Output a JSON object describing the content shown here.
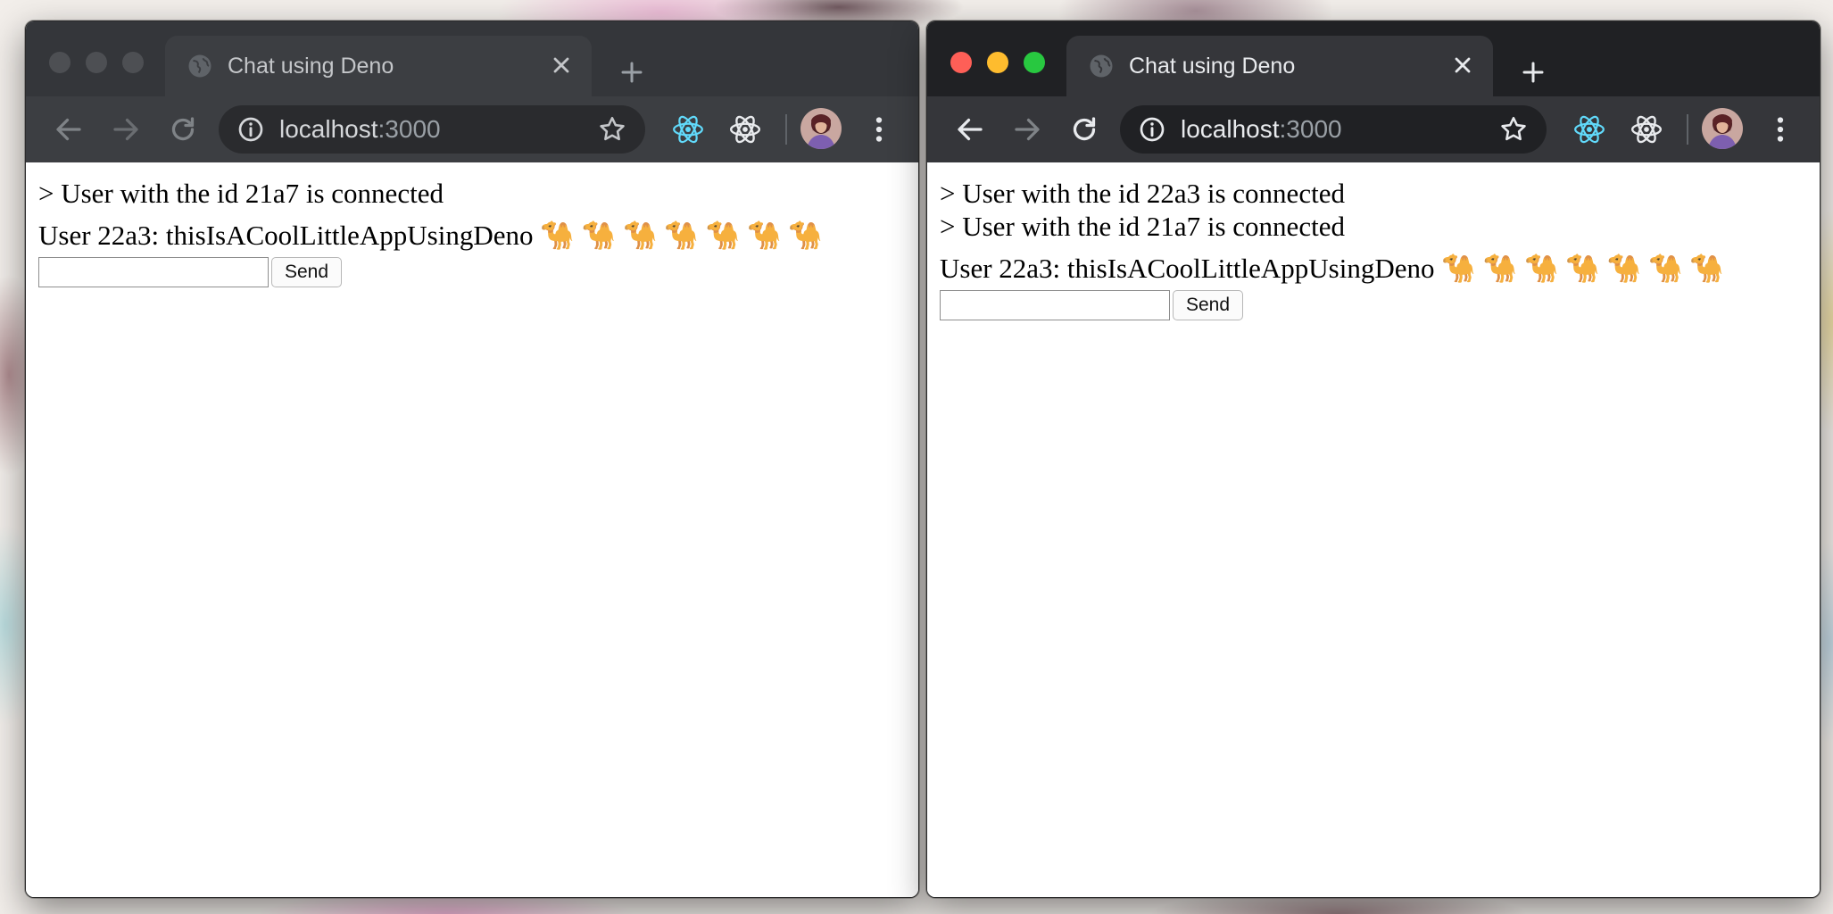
{
  "windows": [
    {
      "id": "left",
      "state": "inactive",
      "tab": {
        "title": "Chat using Deno"
      },
      "address": {
        "host": "localhost",
        "port": ":3000"
      },
      "messages": [
        "> User with the id 21a7 is connected",
        "User 22a3: thisIsACoolLittleAppUsingDeno 🐪 🐪 🐪 🐪 🐪 🐪 🐪"
      ],
      "input": {
        "value": "",
        "placeholder": ""
      },
      "send_label": "Send"
    },
    {
      "id": "right",
      "state": "active",
      "tab": {
        "title": "Chat using Deno"
      },
      "address": {
        "host": "localhost",
        "port": ":3000"
      },
      "messages": [
        "> User with the id 22a3 is connected",
        "> User with the id 21a7 is connected",
        "User 22a3: thisIsACoolLittleAppUsingDeno 🐪 🐪 🐪 🐪 🐪 🐪 🐪"
      ],
      "input": {
        "value": "",
        "placeholder": ""
      },
      "send_label": "Send"
    }
  ],
  "icons": {
    "tab": "globe-icon",
    "close": "close-icon",
    "new_tab": "plus-icon",
    "back": "arrow-left-icon",
    "forward": "arrow-right-icon",
    "reload": "reload-icon",
    "site_info": "info-icon",
    "bookmark": "star-icon",
    "extension_1": "react-devtools-icon",
    "extension_2": "atom-icon",
    "profile": "avatar",
    "menu": "kebab-menu-icon"
  },
  "colors": {
    "titlebar_active": "#202124",
    "toolbar": "#35363a",
    "react_icon": "#61dafb",
    "traffic_red": "#fe5f57",
    "traffic_yellow": "#febc2e",
    "traffic_green": "#28c840"
  }
}
